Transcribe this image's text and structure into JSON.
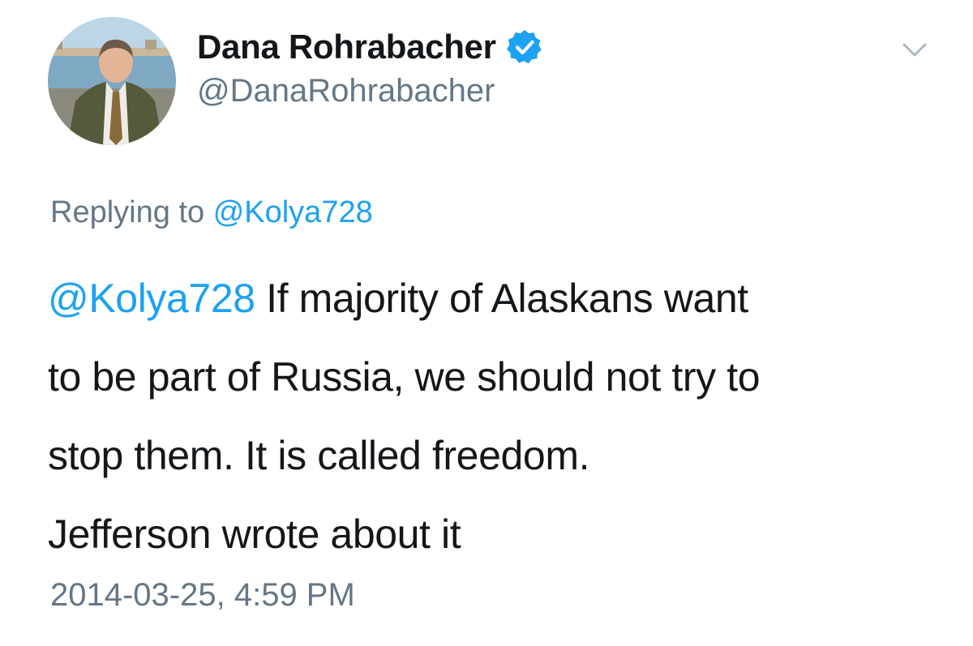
{
  "author": {
    "display_name": "Dana Rohrabacher",
    "handle": "@DanaRohrabacher",
    "verified": true
  },
  "reply_context": {
    "prefix": "Replying to",
    "mention": "@Kolya728"
  },
  "tweet": {
    "mention": "@Kolya728",
    "line1_rest": " If majority of Alaskans want",
    "line2": "to be part of Russia, we should not try to",
    "line3": "stop them. It is called freedom.",
    "line4": "Jefferson wrote about it"
  },
  "timestamp": "2014-03-25, 4:59 PM",
  "icons": {
    "verified": "verified-badge-icon",
    "menu": "chevron-down-icon"
  },
  "colors": {
    "link": "#1da1f2",
    "secondary_text": "#657786",
    "primary_text": "#14171a",
    "verified": "#1da1f2"
  }
}
